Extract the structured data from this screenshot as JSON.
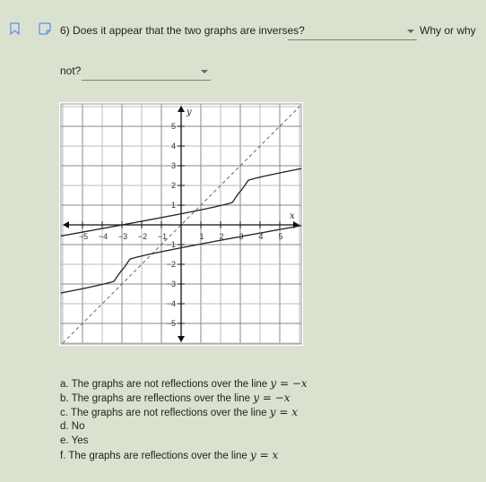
{
  "question": {
    "number": "6)",
    "text_part1": "6) Does it appear that the two graphs are inverses?",
    "text_part2": "Why or why",
    "text_part3": "not?",
    "dropdown1": {
      "selected": ""
    },
    "dropdown2": {
      "selected": ""
    }
  },
  "icons": {
    "bookmark": "bookmark-icon",
    "note": "note-icon",
    "accent_color": "#5b8def"
  },
  "graph": {
    "x_axis_label": "x",
    "y_axis_label": "y",
    "x_ticks": [
      "-5",
      "-4",
      "-3",
      "-2",
      "-1",
      "1",
      "2",
      "3",
      "4",
      "5"
    ],
    "y_ticks": [
      "5",
      "4",
      "3",
      "2",
      "1",
      "-1",
      "-2",
      "-3",
      "-4",
      "-5"
    ],
    "range": {
      "x": [
        -6,
        6
      ],
      "y": [
        -6,
        6
      ]
    },
    "curves": [
      {
        "name": "upper-curve",
        "description": "cubic-like inflection at (3, 2), passing (0, 1)",
        "center": [
          3,
          2
        ]
      },
      {
        "name": "lower-curve",
        "description": "cubic-like inflection at (-3, -2), passing (0, -1)",
        "center": [
          -3,
          -2
        ]
      },
      {
        "name": "line-y-equals-x",
        "style": "dashed",
        "description": "y = x"
      }
    ]
  },
  "options": [
    {
      "letter": "a.",
      "text": "The graphs are not reflections over the line",
      "math_lhs": "y",
      "math_op": "=",
      "math_rhs": "−x"
    },
    {
      "letter": "b.",
      "text": "The graphs are reflections over the line",
      "math_lhs": "y",
      "math_op": "=",
      "math_rhs": "−x"
    },
    {
      "letter": "c.",
      "text": "The graphs are not reflections over the line",
      "math_lhs": "y",
      "math_op": "=",
      "math_rhs": "x"
    },
    {
      "letter": "d.",
      "text": "No"
    },
    {
      "letter": "e.",
      "text": "Yes"
    },
    {
      "letter": "f.",
      "text": "The graphs are reflections over the line",
      "math_lhs": "y",
      "math_op": "=",
      "math_rhs": "x"
    }
  ]
}
